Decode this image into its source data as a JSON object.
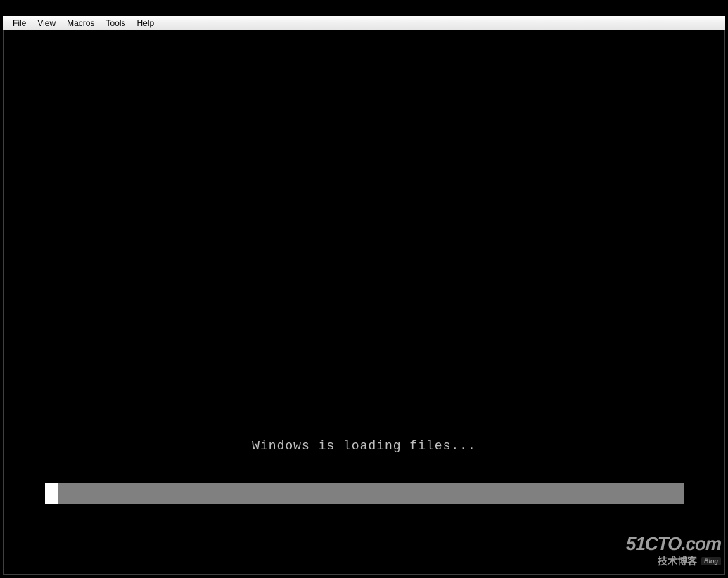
{
  "menu": {
    "items": [
      {
        "label": "File"
      },
      {
        "label": "View"
      },
      {
        "label": "Macros"
      },
      {
        "label": "Tools"
      },
      {
        "label": "Help"
      }
    ]
  },
  "boot": {
    "loading_text": "Windows is loading files...",
    "progress_percent": 2
  },
  "watermark": {
    "main": "51CTO.com",
    "sub": "技术博客",
    "badge": "Blog"
  }
}
